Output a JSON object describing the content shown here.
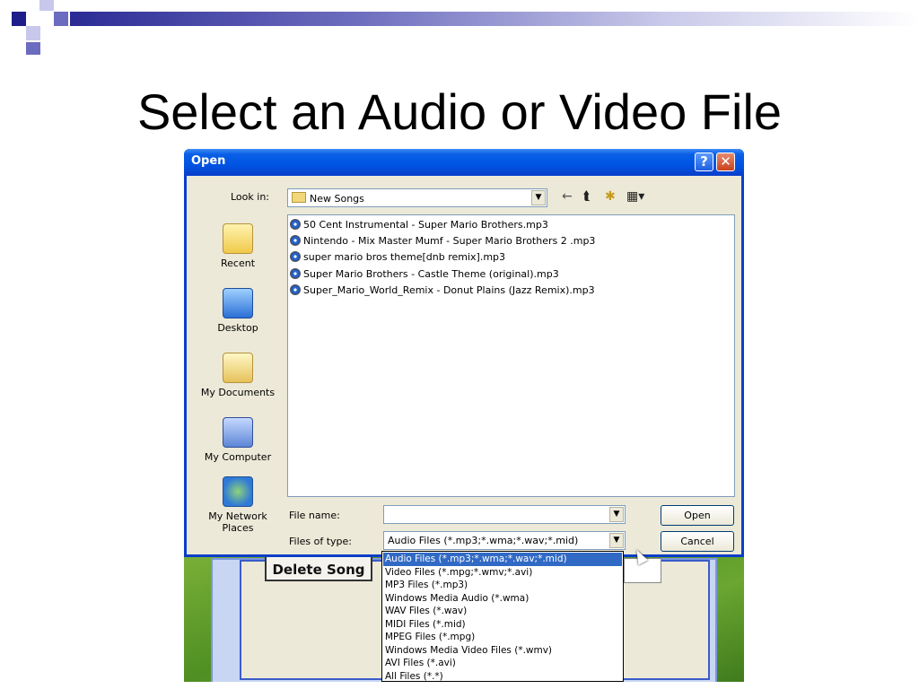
{
  "slide": {
    "title": "Select an Audio or Video File"
  },
  "background_app": {
    "delete_button_label": "Delete Song"
  },
  "dialog": {
    "title": "Open",
    "help_label": "?",
    "close_label": "✕",
    "look_in_label": "Look in:",
    "look_in_value": "New Songs",
    "toolbar": {
      "back_icon": "←",
      "up_folder_icon": "⮬",
      "new_folder_icon": "✱",
      "views_icon": "▦▾"
    },
    "places": [
      {
        "label": "Recent",
        "icon": "recent-icon"
      },
      {
        "label": "Desktop",
        "icon": "desktop-icon"
      },
      {
        "label": "My Documents",
        "icon": "my-documents-icon"
      },
      {
        "label": "My Computer",
        "icon": "my-computer-icon"
      },
      {
        "label": "My Network Places",
        "icon": "network-icon"
      }
    ],
    "files": [
      "50 Cent Instrumental - Super Mario Brothers.mp3",
      "Nintendo - Mix Master Mumf - Super Mario Brothers 2 .mp3",
      "super mario bros theme[dnb remix].mp3",
      "Super Mario Brothers - Castle Theme (original).mp3",
      "Super_Mario_World_Remix - Donut Plains (Jazz Remix).mp3"
    ],
    "file_name_label": "File name:",
    "file_name_value": "",
    "files_of_type_label": "Files of type:",
    "files_of_type_value": "Audio Files (*.mp3;*.wma;*.wav;*.mid)",
    "open_button": "Open",
    "cancel_button": "Cancel",
    "type_options": [
      "Audio Files (*.mp3;*.wma;*.wav;*.mid)",
      "Video Files (*.mpg;*.wmv;*.avi)",
      "MP3 Files (*.mp3)",
      "Windows Media Audio (*.wma)",
      "WAV Files (*.wav)",
      "MIDI Files (*.mid)",
      "MPEG Files (*.mpg)",
      "Windows Media Video Files (*.wmv)",
      "AVI Files (*.avi)",
      "All Files (*.*)"
    ],
    "selected_type_index": 0
  },
  "colors": {
    "titlebar": "#0054e3",
    "selection": "#316ac5",
    "dialog_face": "#ece9d8"
  }
}
